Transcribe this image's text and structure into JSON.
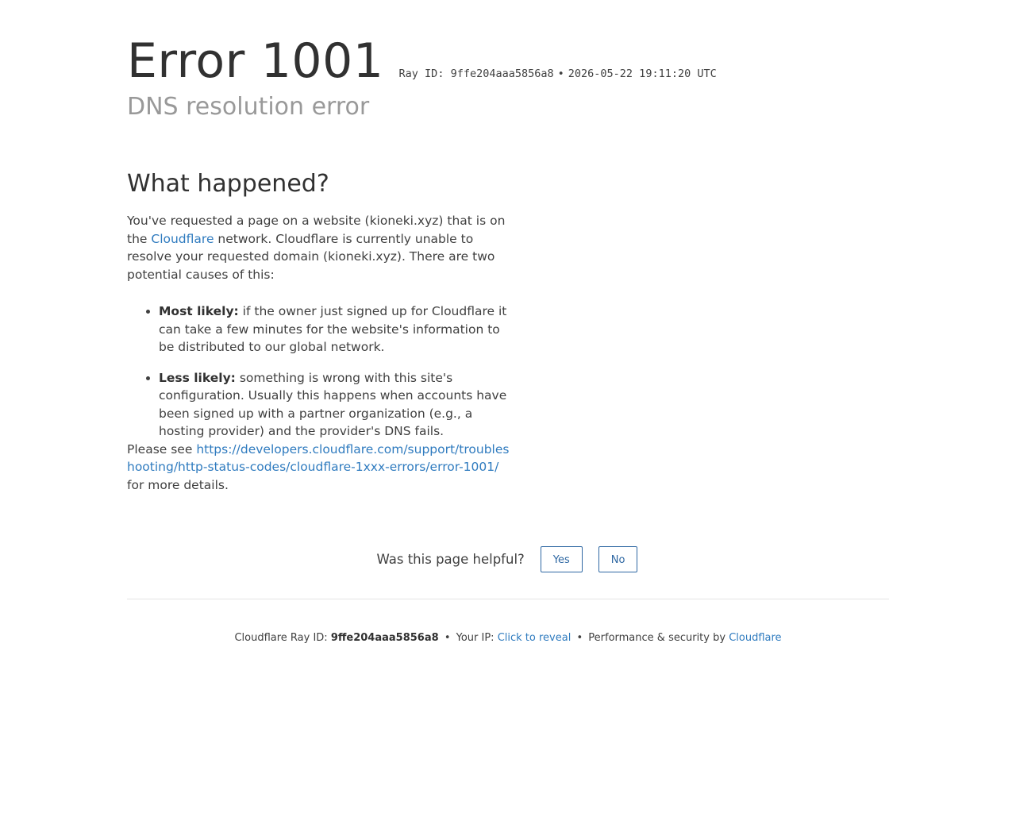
{
  "header": {
    "error_word": "Error",
    "error_code": "1001",
    "ray_label": "Ray ID:",
    "ray_id": "9ffe204aaa5856a8",
    "bullet": "•",
    "timestamp": "2026-05-22 19:11:20 UTC",
    "subtitle": "DNS resolution error"
  },
  "what_happened": {
    "heading": "What happened?",
    "intro_part1": "You've requested a page on a website (kioneki.xyz) that is on the ",
    "intro_link": "Cloudflare",
    "intro_part2": " network. Cloudflare is currently unable to resolve your requested domain (kioneki.xyz). There are two potential causes of this:",
    "causes": [
      {
        "label": "Most likely:",
        "text": " if the owner just signed up for Cloudflare it can take a few minutes for the website's information to be distributed to our global network."
      },
      {
        "label": "Less likely:",
        "text": " something is wrong with this site's configuration. Usually this happens when accounts have been signed up with a partner organization (e.g., a hosting provider) and the provider's DNS fails."
      }
    ],
    "see_prefix": "Please see ",
    "see_link": "https://developers.cloudflare.com/support/troubleshooting/http-status-codes/cloudflare-1xxx-errors/error-1001/",
    "see_suffix": " for more details."
  },
  "feedback": {
    "question": "Was this page helpful?",
    "yes_label": "Yes",
    "no_label": "No"
  },
  "footer": {
    "ray_label": "Cloudflare Ray ID: ",
    "ray_id": "9ffe204aaa5856a8",
    "bullet": "•",
    "ip_label": "Your IP: ",
    "ip_link": "Click to reveal",
    "perf_label": "Performance & security by ",
    "perf_link": "Cloudflare"
  }
}
